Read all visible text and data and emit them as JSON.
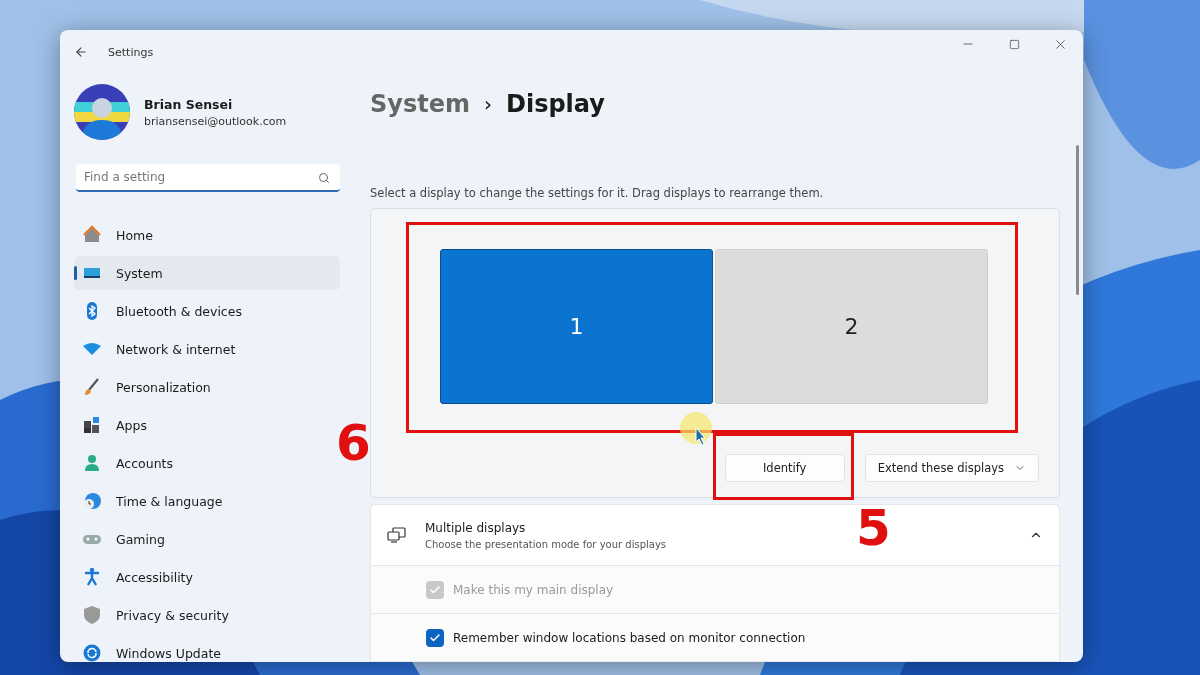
{
  "window": {
    "title": "Settings"
  },
  "profile": {
    "name": "Brian Sensei",
    "email": "briansensei@outlook.com"
  },
  "search": {
    "placeholder": "Find a setting"
  },
  "nav": [
    {
      "label": "Home",
      "selected": false
    },
    {
      "label": "System",
      "selected": true
    },
    {
      "label": "Bluetooth & devices",
      "selected": false
    },
    {
      "label": "Network & internet",
      "selected": false
    },
    {
      "label": "Personalization",
      "selected": false
    },
    {
      "label": "Apps",
      "selected": false
    },
    {
      "label": "Accounts",
      "selected": false
    },
    {
      "label": "Time & language",
      "selected": false
    },
    {
      "label": "Gaming",
      "selected": false
    },
    {
      "label": "Accessibility",
      "selected": false
    },
    {
      "label": "Privacy & security",
      "selected": false
    },
    {
      "label": "Windows Update",
      "selected": false
    }
  ],
  "breadcrumb": [
    "System",
    "›",
    "Display"
  ],
  "description": "Select a display to change the settings for it. Drag displays to rearrange them.",
  "displays": [
    {
      "label": "1",
      "selected": true
    },
    {
      "label": "2",
      "selected": false
    }
  ],
  "identify_button": "Identify",
  "mode_dropdown": {
    "value": "Extend these displays"
  },
  "section": {
    "title": "Multiple displays",
    "subtitle": "Choose the presentation mode for your displays",
    "expanded": true
  },
  "options": [
    {
      "label": "Make this my main display",
      "checked": true,
      "disabled": true
    },
    {
      "label": "Remember window locations based on monitor connection",
      "checked": true,
      "disabled": false
    }
  ],
  "annotations": [
    {
      "label": "6"
    },
    {
      "label": "5"
    }
  ]
}
